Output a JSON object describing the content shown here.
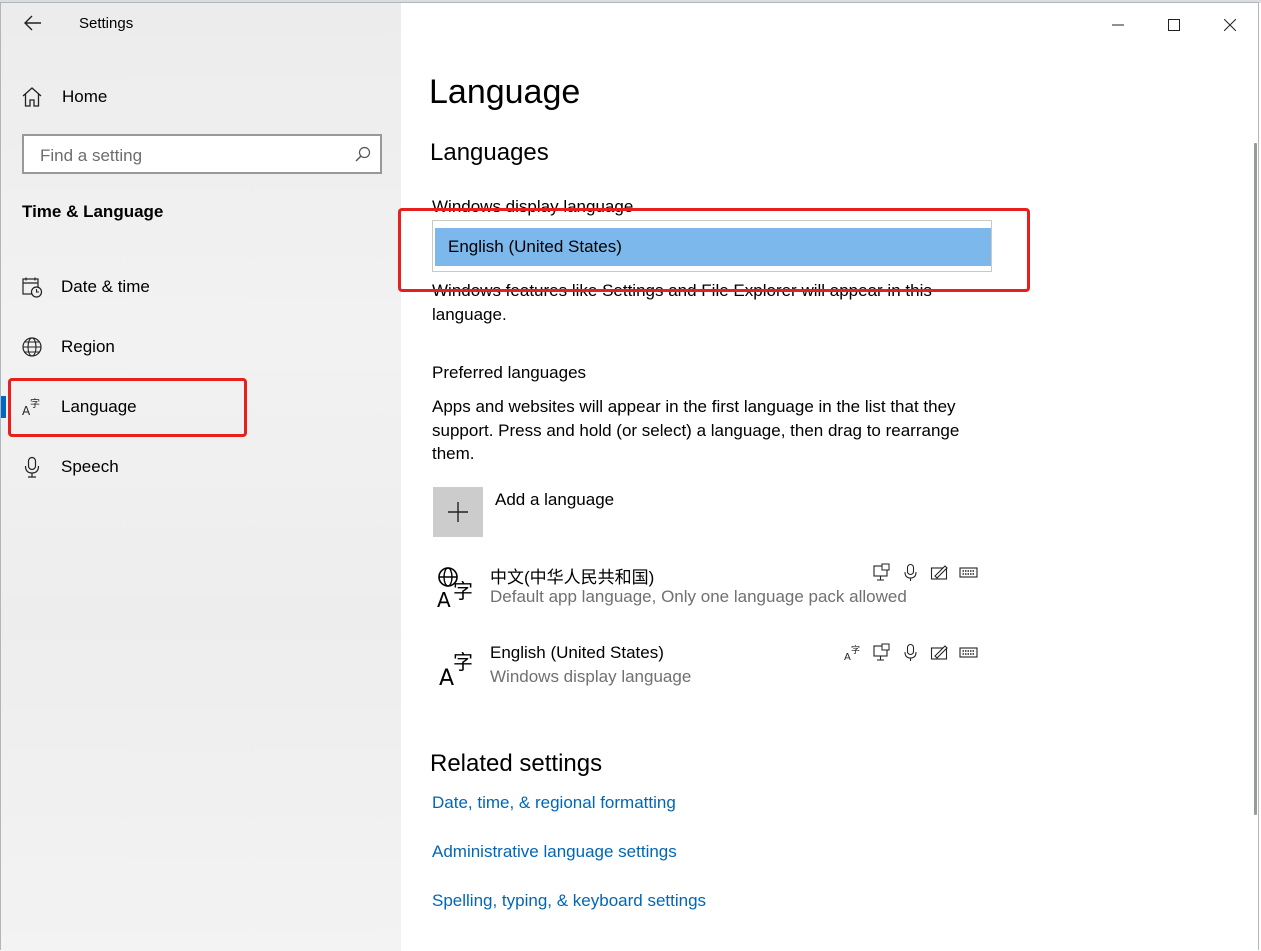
{
  "window": {
    "title": "Settings",
    "controls": {
      "minimize": "minimize",
      "maximize": "maximize",
      "close": "close"
    }
  },
  "sidebar": {
    "home_label": "Home",
    "search_placeholder": "Find a setting",
    "section_title": "Time & Language",
    "items": [
      {
        "label": "Date & time",
        "icon": "calendar-clock-icon"
      },
      {
        "label": "Region",
        "icon": "globe-icon"
      },
      {
        "label": "Language",
        "icon": "language-icon",
        "selected": true
      },
      {
        "label": "Speech",
        "icon": "microphone-icon"
      }
    ]
  },
  "main": {
    "title": "Language",
    "languages_heading": "Languages",
    "display_language": {
      "label": "Windows display language",
      "selected": "English (United States)",
      "description": "Windows features like Settings and File Explorer will appear in this language."
    },
    "preferred": {
      "label": "Preferred languages",
      "description": "Apps and websites will appear in the first language in the list that they support. Press and hold (or select) a language, then drag to rearrange them.",
      "add_label": "Add a language",
      "languages": [
        {
          "name": "中文(中华人民共和国)",
          "subtitle": "Default app language, Only one language pack allowed"
        },
        {
          "name": "English (United States)",
          "subtitle": "Windows display language"
        }
      ]
    },
    "related": {
      "heading": "Related settings",
      "links": [
        "Date, time, & regional formatting",
        "Administrative language settings",
        "Spelling, typing, & keyboard settings"
      ]
    }
  },
  "colors": {
    "accent": "#0067c0",
    "link": "#0067b8",
    "highlight": "#7cb8ec",
    "annotation_red": "#e8201d"
  }
}
